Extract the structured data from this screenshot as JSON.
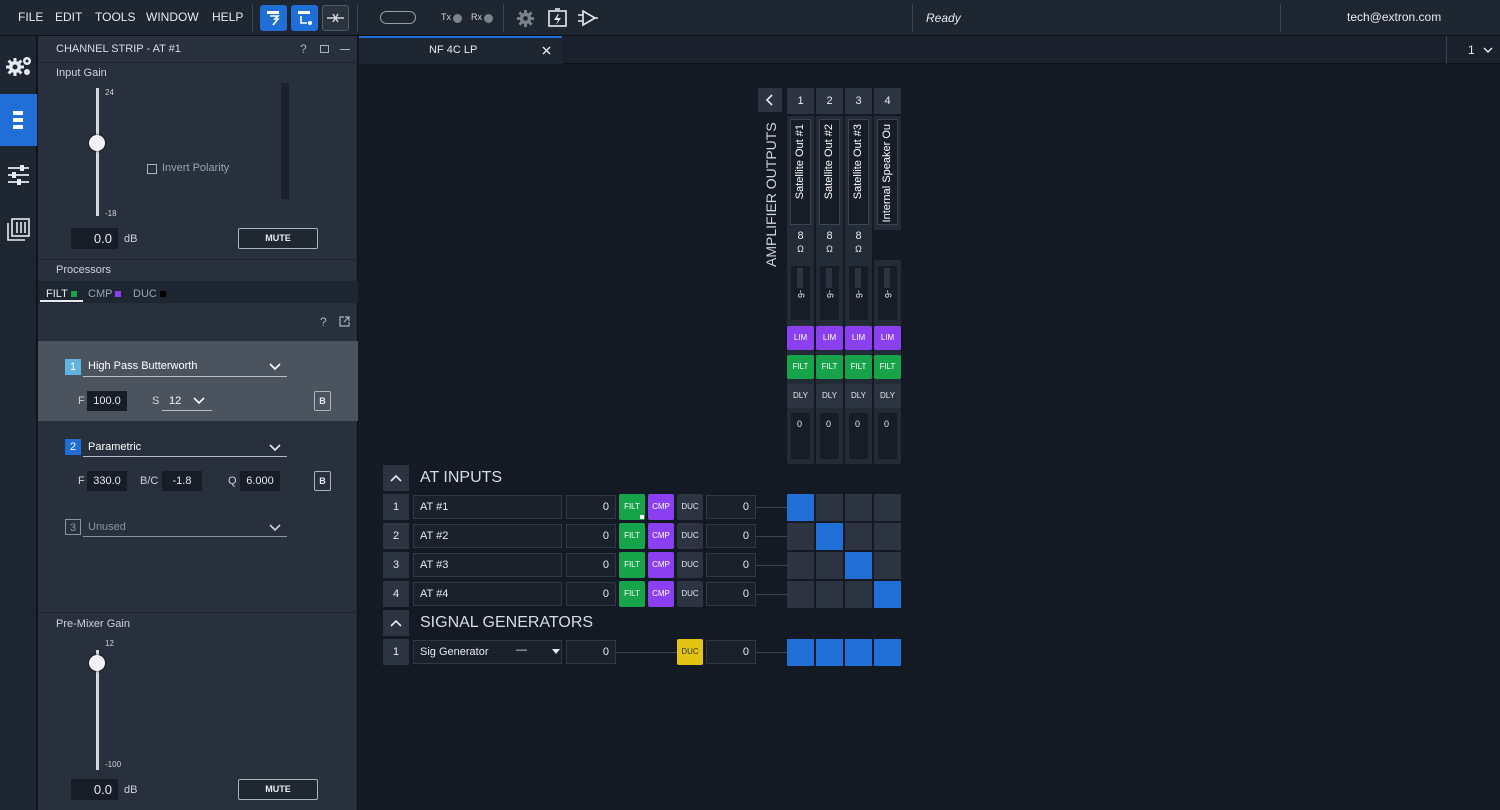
{
  "menu": [
    "FILE",
    "EDIT",
    "TOOLS",
    "WINDOW",
    "HELP"
  ],
  "status": {
    "tx": "Tx",
    "rx": "Rx",
    "ready": "Ready",
    "user": "tech@extron.com"
  },
  "rail": {
    "items": [
      "gear-config-icon",
      "channel-strip-icon",
      "sliders-icon",
      "mixer-icon"
    ],
    "active_index": 1
  },
  "channel_strip": {
    "title": "CHANNEL STRIP - AT #1",
    "help": "?",
    "input_gain": {
      "label": "Input Gain",
      "max": "24",
      "min": "-18",
      "value": "0.0",
      "unit": "dB",
      "level": 0.571
    },
    "invert_polarity": "Invert Polarity",
    "mute": "MUTE",
    "processors_label": "Processors",
    "tabs": [
      {
        "label": "FILT",
        "color": "#17a34a"
      },
      {
        "label": "CMP",
        "color": "#8a3ff0"
      },
      {
        "label": "DUC",
        "color": "#000000"
      }
    ],
    "filters": [
      {
        "num": "1",
        "type": "High Pass Butterworth",
        "f_label": "F",
        "f_value": "100.0",
        "s_label": "S",
        "s_value": "12",
        "b": "B"
      },
      {
        "num": "2",
        "type": "Parametric",
        "f_label": "F",
        "f_value": "330.0",
        "bc_label": "B/C",
        "bc_value": "-1.8",
        "q_label": "Q",
        "q_value": "6.000",
        "b": "B"
      },
      {
        "num": "3",
        "type": "Unused"
      }
    ],
    "pre_mixer_gain": {
      "label": "Pre-Mixer Gain",
      "max": "12",
      "min": "-100",
      "value": "0.0",
      "unit": "dB",
      "mute": "MUTE",
      "level": 0.893
    }
  },
  "doc": {
    "tab_title": "NF 4C LP",
    "page_selector": "1"
  },
  "outputs": {
    "header": "AMPLIFIER OUTPUTS",
    "columns": [
      {
        "num": "1",
        "name": "Satellite Out #1",
        "ohm": "8",
        "gain": "-6",
        "lim": "LIM",
        "filt": "FILT",
        "dly": "DLY",
        "level": "0"
      },
      {
        "num": "2",
        "name": "Satellite Out #2",
        "ohm": "8",
        "gain": "-6",
        "lim": "LIM",
        "filt": "FILT",
        "dly": "DLY",
        "level": "0"
      },
      {
        "num": "3",
        "name": "Satellite Out #3",
        "ohm": "8",
        "gain": "-6",
        "lim": "LIM",
        "filt": "FILT",
        "dly": "DLY",
        "level": "0"
      },
      {
        "num": "4",
        "name": "Internal Speaker Ou",
        "ohm": "",
        "gain": "-6",
        "lim": "LIM",
        "filt": "FILT",
        "dly": "DLY",
        "level": "0"
      }
    ],
    "ohm_symbol": "Ω"
  },
  "inputs": {
    "header": "AT INPUTS",
    "rows": [
      {
        "num": "1",
        "name": "AT #1",
        "gain": "0",
        "filt": "FILT",
        "cmp": "CMP",
        "duc": "DUC",
        "post": "0",
        "routes": [
          true,
          false,
          false,
          false
        ]
      },
      {
        "num": "2",
        "name": "AT #2",
        "gain": "0",
        "filt": "FILT",
        "cmp": "CMP",
        "duc": "DUC",
        "post": "0",
        "routes": [
          false,
          true,
          false,
          false
        ]
      },
      {
        "num": "3",
        "name": "AT #3",
        "gain": "0",
        "filt": "FILT",
        "cmp": "CMP",
        "duc": "DUC",
        "post": "0",
        "routes": [
          false,
          false,
          true,
          false
        ]
      },
      {
        "num": "4",
        "name": "AT #4",
        "gain": "0",
        "filt": "FILT",
        "cmp": "CMP",
        "duc": "DUC",
        "post": "0",
        "routes": [
          false,
          false,
          false,
          true
        ]
      }
    ]
  },
  "generators": {
    "header": "SIGNAL GENERATORS",
    "rows": [
      {
        "num": "1",
        "name": "Sig Generator",
        "mode": "—",
        "gain": "0",
        "duc": "DUC",
        "post": "0",
        "routes": [
          true,
          true,
          true,
          true
        ]
      }
    ]
  }
}
